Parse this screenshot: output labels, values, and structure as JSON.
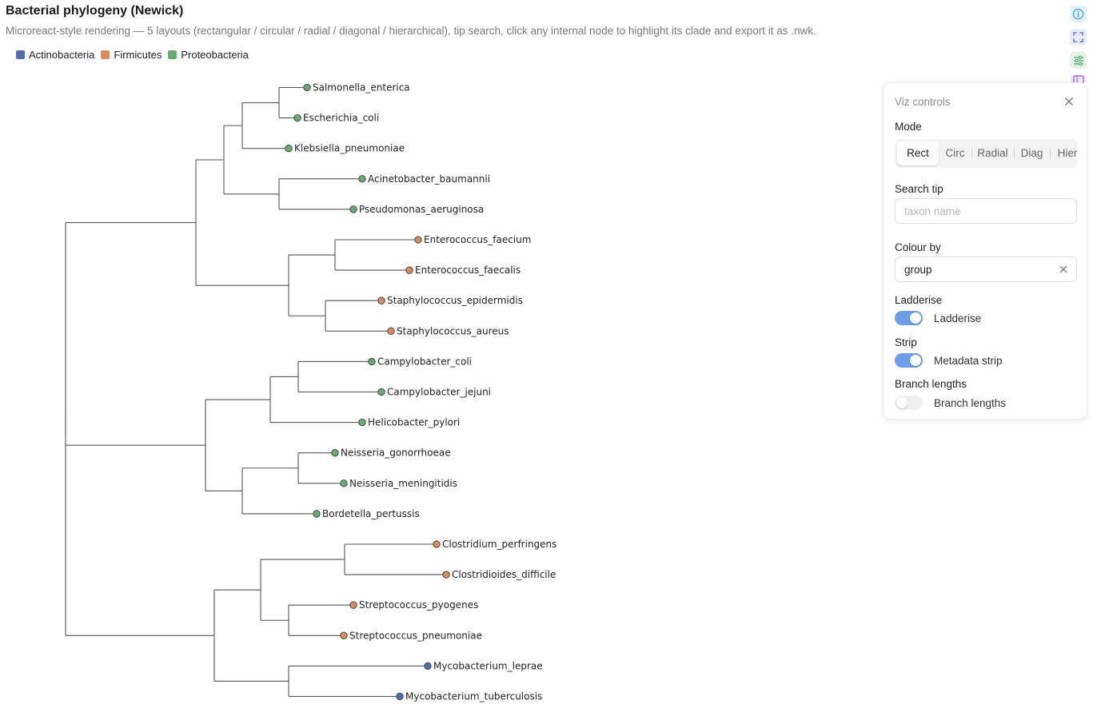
{
  "header": {
    "title": "Bacterial phylogeny (Newick)",
    "subtitle": "Microreact-style rendering — 5 layouts (rectangular / circular / radial / diagonal / hierarchical), tip search, click any internal node to highlight its clade and export it as .nwk."
  },
  "legend": [
    {
      "label": "Actinobacteria",
      "color": "#4f6fad"
    },
    {
      "label": "Firmicutes",
      "color": "#d98c5f"
    },
    {
      "label": "Proteobacteria",
      "color": "#6aab73"
    }
  ],
  "tree": {
    "tips": [
      {
        "name": "Salmonella_enterica",
        "group": "Proteobacteria"
      },
      {
        "name": "Escherichia_coli",
        "group": "Proteobacteria"
      },
      {
        "name": "Klebsiella_pneumoniae",
        "group": "Proteobacteria"
      },
      {
        "name": "Acinetobacter_baumannii",
        "group": "Proteobacteria"
      },
      {
        "name": "Pseudomonas_aeruginosa",
        "group": "Proteobacteria"
      },
      {
        "name": "Enterococcus_faecium",
        "group": "Firmicutes"
      },
      {
        "name": "Enterococcus_faecalis",
        "group": "Firmicutes"
      },
      {
        "name": "Staphylococcus_epidermidis",
        "group": "Firmicutes"
      },
      {
        "name": "Staphylococcus_aureus",
        "group": "Firmicutes"
      },
      {
        "name": "Campylobacter_coli",
        "group": "Proteobacteria"
      },
      {
        "name": "Campylobacter_jejuni",
        "group": "Proteobacteria"
      },
      {
        "name": "Helicobacter_pylori",
        "group": "Proteobacteria"
      },
      {
        "name": "Neisseria_gonorrhoeae",
        "group": "Proteobacteria"
      },
      {
        "name": "Neisseria_meningitidis",
        "group": "Proteobacteria"
      },
      {
        "name": "Bordetella_pertussis",
        "group": "Proteobacteria"
      },
      {
        "name": "Clostridium_perfringens",
        "group": "Firmicutes"
      },
      {
        "name": "Clostridioides_difficile",
        "group": "Firmicutes"
      },
      {
        "name": "Streptococcus_pyogenes",
        "group": "Firmicutes"
      },
      {
        "name": "Streptococcus_pneumoniae",
        "group": "Firmicutes"
      },
      {
        "name": "Mycobacterium_leprae",
        "group": "Actinobacteria"
      },
      {
        "name": "Mycobacterium_tuberculosis",
        "group": "Actinobacteria"
      }
    ]
  },
  "side_icons": [
    "info-icon",
    "fullscreen-icon",
    "sliders-icon",
    "layout-icon"
  ],
  "panel": {
    "title": "Viz controls",
    "mode_label": "Mode",
    "modes": [
      "Rect",
      "Circ",
      "Radial",
      "Diag",
      "Hier"
    ],
    "active_mode": "Rect",
    "search_label": "Search tip",
    "search_placeholder": "taxon name",
    "search_value": "",
    "colour_label": "Colour by",
    "colour_value": "group",
    "ladderise_label": "Ladderise",
    "ladderise_toggle": "Ladderise",
    "ladderise_on": true,
    "strip_label": "Strip",
    "strip_toggle": "Metadata strip",
    "strip_on": true,
    "branch_label": "Branch lengths",
    "branch_toggle": "Branch lengths",
    "branch_on": false
  }
}
